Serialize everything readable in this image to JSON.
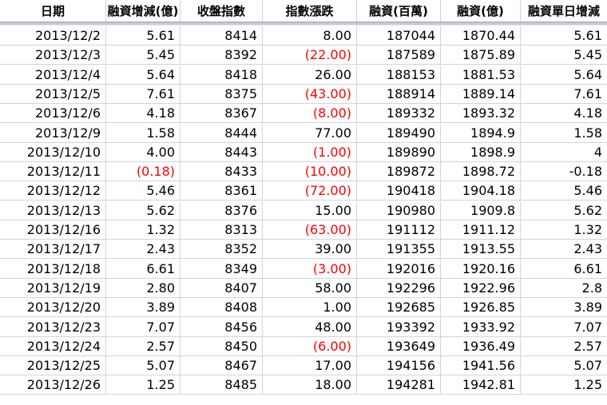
{
  "headers": [
    "日期",
    "融資增減(億)",
    "收盤指數",
    "指數漲跌",
    "融資(百萬)",
    "融資(億)",
    "融資單日增減"
  ],
  "rows": [
    [
      "2013/12/2",
      "5.61",
      "8414",
      "8.00",
      "187044",
      "1870.44",
      "5.61"
    ],
    [
      "2013/12/3",
      "5.45",
      "8392",
      "(22.00)",
      "187589",
      "1875.89",
      "5.45"
    ],
    [
      "2013/12/4",
      "5.64",
      "8418",
      "26.00",
      "188153",
      "1881.53",
      "5.64"
    ],
    [
      "2013/12/5",
      "7.61",
      "8375",
      "(43.00)",
      "188914",
      "1889.14",
      "7.61"
    ],
    [
      "2013/12/6",
      "4.18",
      "8367",
      "(8.00)",
      "189332",
      "1893.32",
      "4.18"
    ],
    [
      "2013/12/9",
      "1.58",
      "8444",
      "77.00",
      "189490",
      "1894.9",
      "1.58"
    ],
    [
      "2013/12/10",
      "4.00",
      "8443",
      "(1.00)",
      "189890",
      "1898.9",
      "4"
    ],
    [
      "2013/12/11",
      "(0.18)",
      "8433",
      "(10.00)",
      "189872",
      "1898.72",
      "-0.18"
    ],
    [
      "2013/12/12",
      "5.46",
      "8361",
      "(72.00)",
      "190418",
      "1904.18",
      "5.46"
    ],
    [
      "2013/12/13",
      "5.62",
      "8376",
      "15.00",
      "190980",
      "1909.8",
      "5.62"
    ],
    [
      "2013/12/16",
      "1.32",
      "8313",
      "(63.00)",
      "191112",
      "1911.12",
      "1.32"
    ],
    [
      "2013/12/17",
      "2.43",
      "8352",
      "39.00",
      "191355",
      "1913.55",
      "2.43"
    ],
    [
      "2013/12/18",
      "6.61",
      "8349",
      "(3.00)",
      "192016",
      "1920.16",
      "6.61"
    ],
    [
      "2013/12/19",
      "2.80",
      "8407",
      "58.00",
      "192296",
      "1922.96",
      "2.8"
    ],
    [
      "2013/12/20",
      "3.89",
      "8408",
      "1.00",
      "192685",
      "1926.85",
      "3.89"
    ],
    [
      "2013/12/23",
      "7.07",
      "8456",
      "48.00",
      "193392",
      "1933.92",
      "7.07"
    ],
    [
      "2013/12/24",
      "2.57",
      "8450",
      "(6.00)",
      "193649",
      "1936.49",
      "2.57"
    ],
    [
      "2013/12/25",
      "5.07",
      "8467",
      "17.00",
      "194156",
      "1941.56",
      "5.07"
    ],
    [
      "2013/12/26",
      "1.25",
      "8485",
      "18.00",
      "194281",
      "1942.81",
      "1.25"
    ]
  ],
  "colors": {
    "negative_text": "#ff0000",
    "header_rule": "#c5cbd6",
    "grid": "#d4d4d4"
  }
}
